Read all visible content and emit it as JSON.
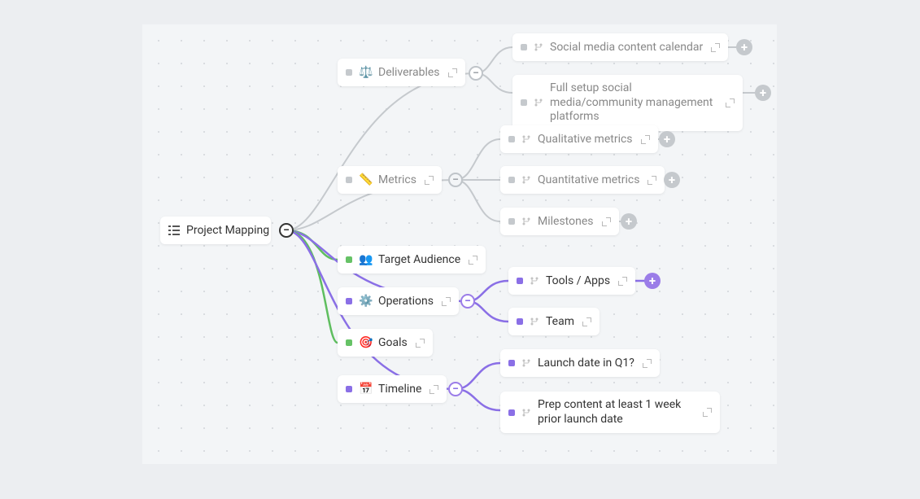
{
  "root": {
    "label": "Project Mapping"
  },
  "level1": {
    "deliverables": {
      "icon": "⚖️",
      "label": "Deliverables",
      "color": "gray"
    },
    "metrics": {
      "icon": "📏",
      "label": "Metrics",
      "color": "gray"
    },
    "target": {
      "icon": "👥",
      "label": "Target Audience",
      "color": "green"
    },
    "operations": {
      "icon": "⚙️",
      "label": "Operations",
      "color": "purple"
    },
    "goals": {
      "icon": "🎯",
      "label": "Goals",
      "color": "green"
    },
    "timeline": {
      "icon": "📅",
      "label": "Timeline",
      "color": "purple"
    }
  },
  "children": {
    "deliverables": [
      {
        "label": "Social media content calendar",
        "color": "gray"
      },
      {
        "label": "Full setup social media/community management platforms",
        "color": "gray"
      }
    ],
    "metrics": [
      {
        "label": "Qualitative metrics",
        "color": "gray"
      },
      {
        "label": "Quantitative metrics",
        "color": "gray"
      },
      {
        "label": "Milestones",
        "color": "gray"
      }
    ],
    "operations": [
      {
        "label": "Tools / Apps",
        "color": "purple"
      },
      {
        "label": "Team",
        "color": "purple"
      }
    ],
    "timeline": [
      {
        "label": "Launch date in Q1?",
        "color": "purple"
      },
      {
        "label": "Prep content at least 1 week prior launch date",
        "color": "purple"
      }
    ]
  }
}
